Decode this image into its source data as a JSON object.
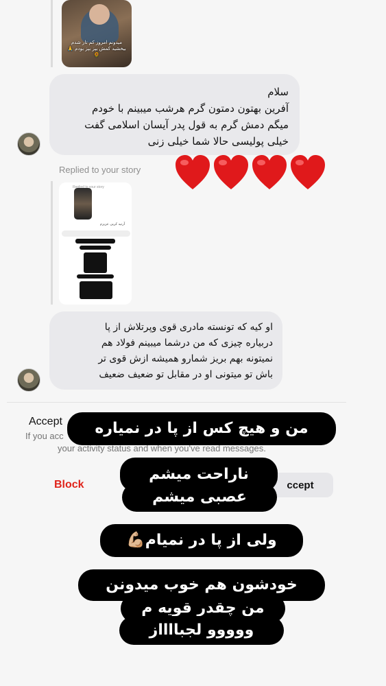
{
  "story_preview": {
    "caption": "میدونم امروز کم تار شدم\nبیخشید کمش بپز بپز\nبودم 🙏🌻"
  },
  "messages": [
    {
      "text": "سلام\nآفرین بهتون دمتون گرم هرشب میبینم با خودم\nمیگم دمش گرم به قول پدر آیسان اسلامی گفت\nخیلی پولیسی حالا شما خیلی زنی"
    },
    {
      "text": "او کیه که تونسته مادری قوی وپرتلاش از پا\nدربیاره چیزی که من درشما میبینم فولاد هم\nنمیتونه بهم بریز شمارو همیشه ازش قوی تر\nباش تو میتونی او در مقابل تو ضعیف ضعیف"
    }
  ],
  "replied_label": "Replied to your story",
  "reaction_emoji": "heart-icon",
  "reaction_count": 4,
  "reply_story": {
    "header": "Replied to your story",
    "row": "آرتیه کریی عزیزم"
  },
  "request": {
    "title": "Accept",
    "subtitle_line1": "If you acc",
    "subtitle_line2": "your activity status and when you've read messages.",
    "block_label": "Block",
    "accept_label": "ccept"
  },
  "overlays": {
    "line1": "من و هیچ کس از پا در نمیاره",
    "line2": "ناراحت میشم",
    "line3": "عصبی میشم",
    "line4": "ولی از پا در نمیام💪🏼",
    "line5": "خودشون هم خوب میدونن",
    "line6": "من چقدر قویه م",
    "line7": "ووووو لجبااااز"
  },
  "colors": {
    "bubble": "#e9e9ec",
    "block": "#e0241b",
    "overlay_bg": "#000000",
    "heart": "#e0191b"
  }
}
